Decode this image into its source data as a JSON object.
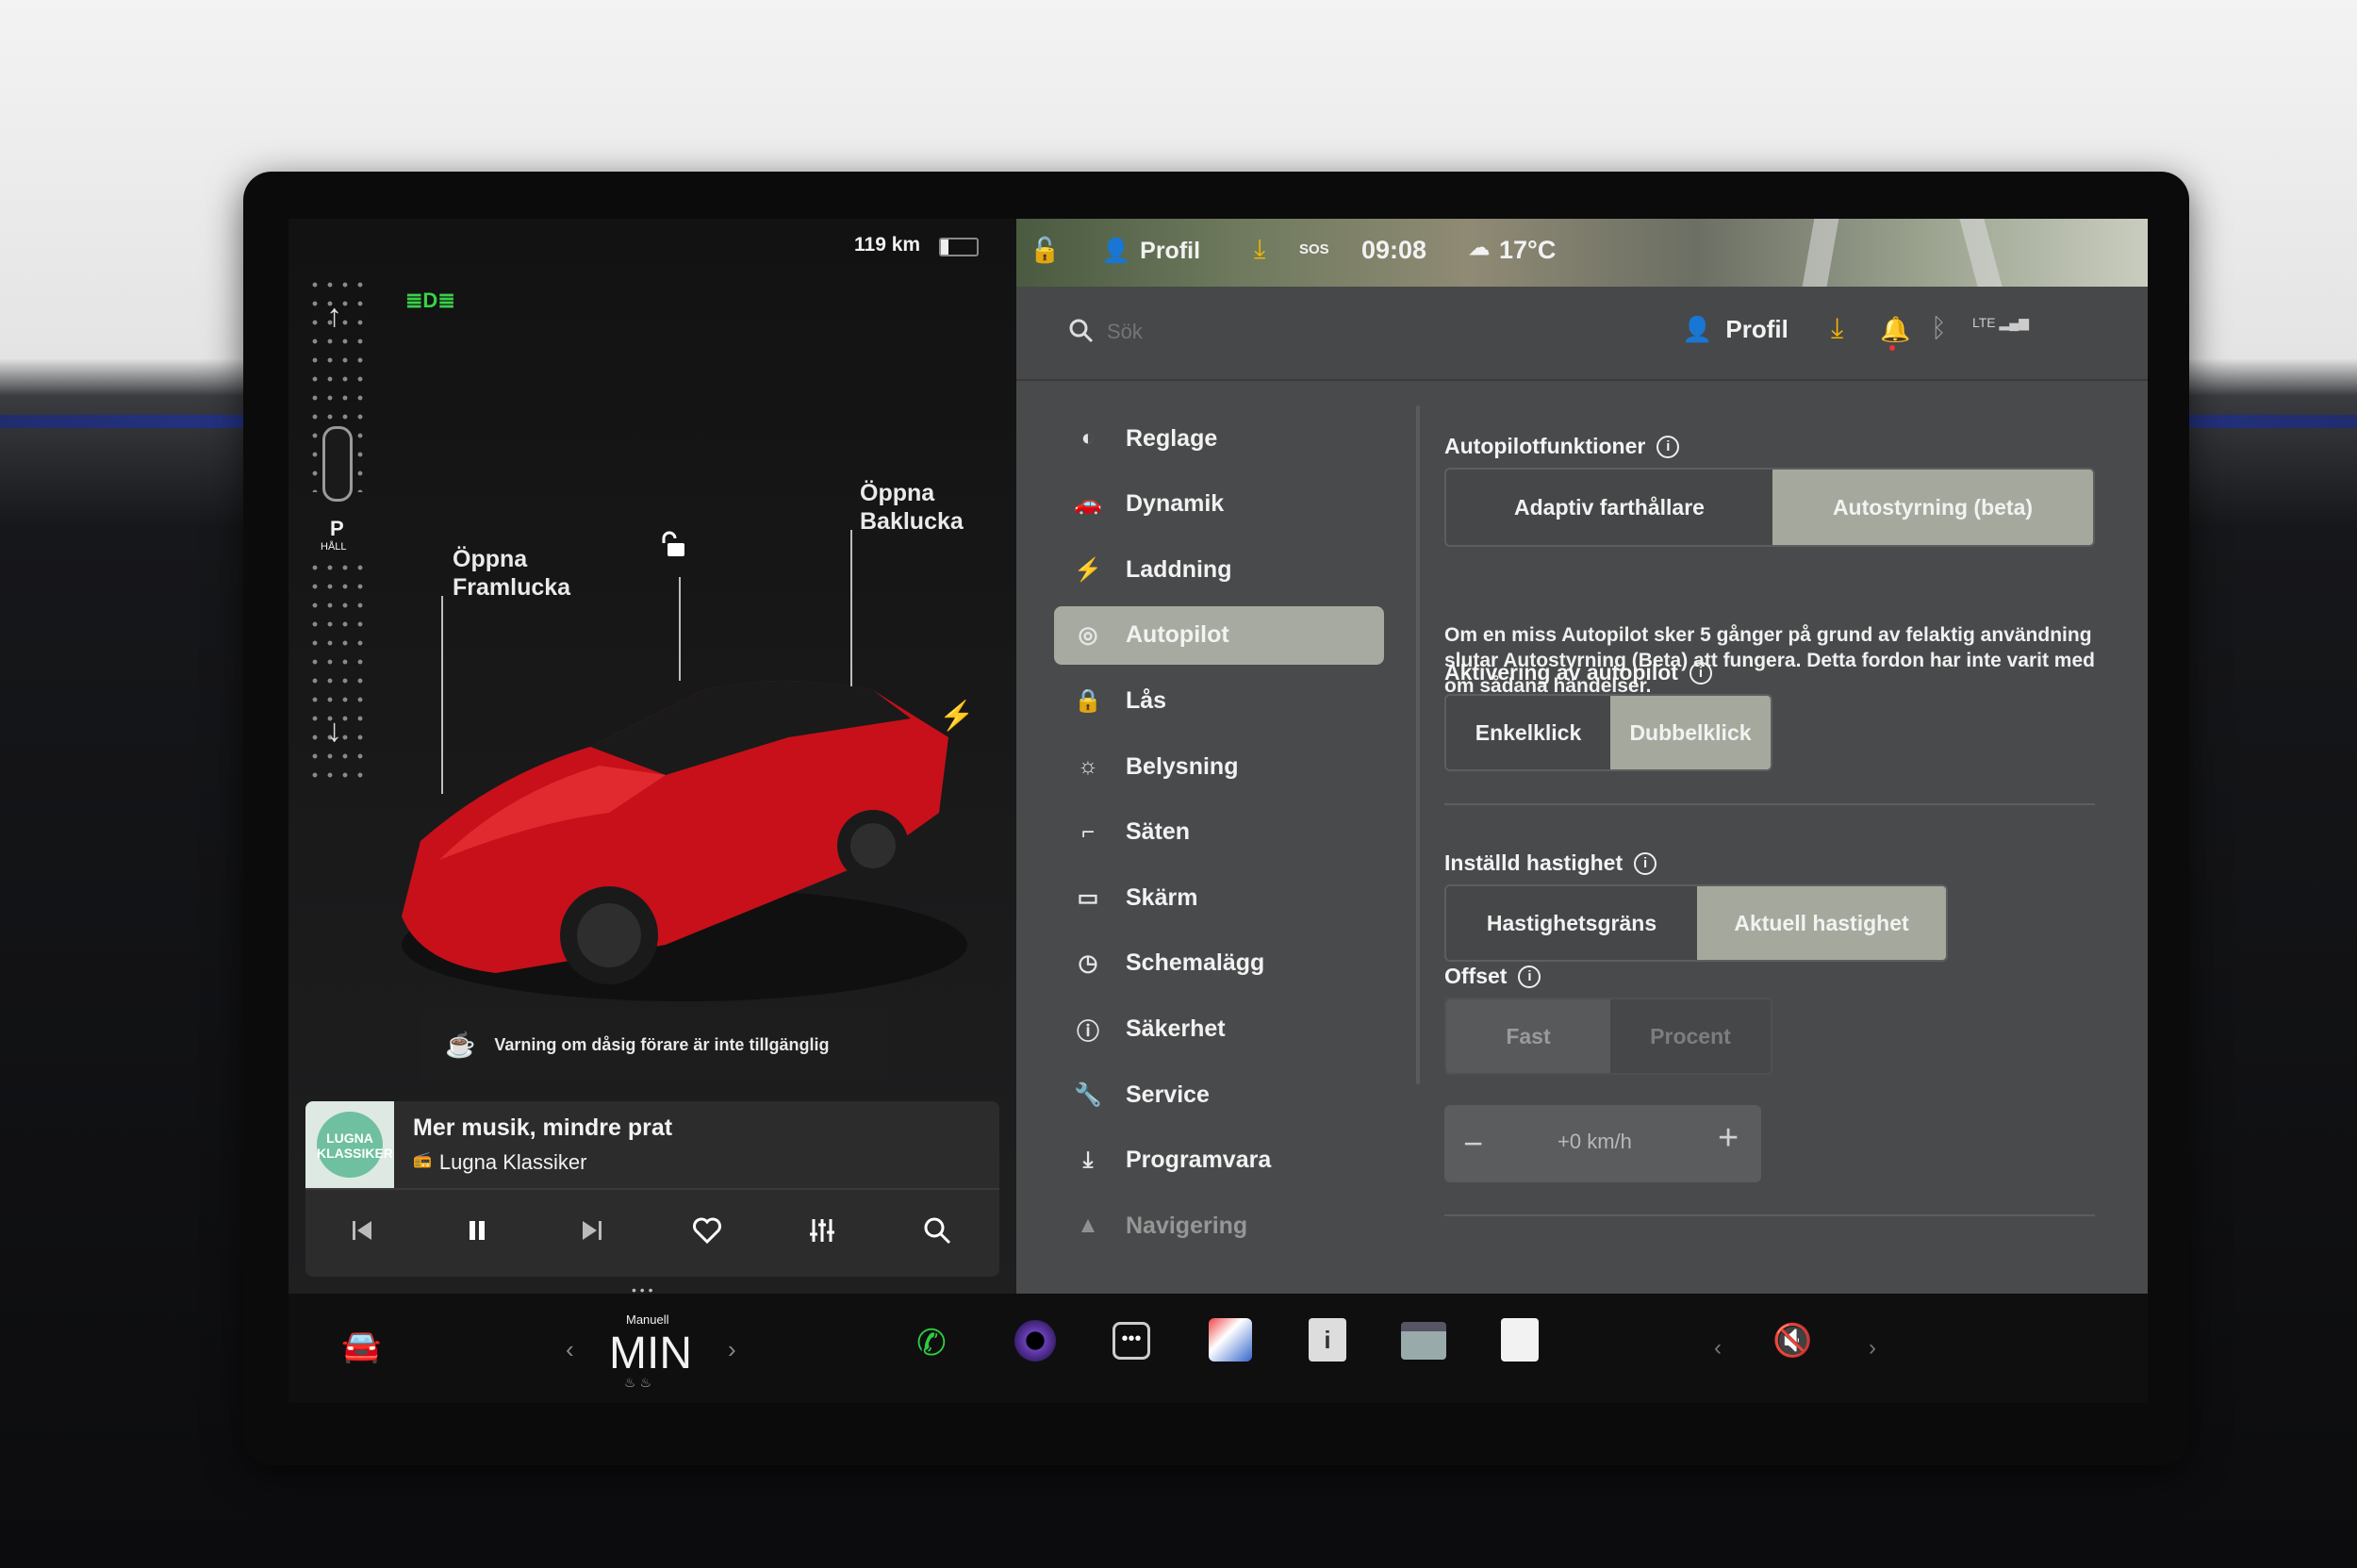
{
  "status": {
    "range": "119 km",
    "profile": "Profil",
    "time": "09:08",
    "temperature": "17°C",
    "sos": "SOS"
  },
  "left": {
    "gear": "P",
    "gear_sub": "HÅLL",
    "front_trunk": [
      "Öppna",
      "Framlucka"
    ],
    "rear_trunk": [
      "Öppna",
      "Baklucka"
    ],
    "warning": "Varning om dåsig förare är inte tillgänglig"
  },
  "media": {
    "title": "Mer musik, mindre prat",
    "station": "Lugna Klassiker",
    "album_text": "LUGNA KLASSIKER"
  },
  "search": {
    "placeholder": "Sök",
    "profile": "Profil"
  },
  "menu": [
    {
      "label": "Reglage",
      "icon": "toggle-icon"
    },
    {
      "label": "Dynamik",
      "icon": "car-icon"
    },
    {
      "label": "Laddning",
      "icon": "bolt-icon"
    },
    {
      "label": "Autopilot",
      "icon": "steering-wheel-icon",
      "selected": true
    },
    {
      "label": "Lås",
      "icon": "lock-icon"
    },
    {
      "label": "Belysning",
      "icon": "sun-icon"
    },
    {
      "label": "Säten",
      "icon": "seat-icon"
    },
    {
      "label": "Skärm",
      "icon": "display-icon"
    },
    {
      "label": "Schemalägg",
      "icon": "clock-icon"
    },
    {
      "label": "Säkerhet",
      "icon": "info-icon"
    },
    {
      "label": "Service",
      "icon": "wrench-icon"
    },
    {
      "label": "Programvara",
      "icon": "download-icon"
    },
    {
      "label": "Navigering",
      "icon": "navigation-icon"
    }
  ],
  "settings": {
    "autopilot_features": {
      "title": "Autopilotfunktioner",
      "options": [
        "Adaptiv farthållare",
        "Autostyrning (beta)"
      ],
      "selected": 1,
      "note": "Om en miss Autopilot sker 5 gånger på grund av felaktig användning slutar Autostyrning (Beta) att fungera. Detta fordon har inte varit med om sådana händelser."
    },
    "activation": {
      "title": "Aktivering av autopilot",
      "options": [
        "Enkelklick",
        "Dubbelklick"
      ],
      "selected": 1
    },
    "set_speed": {
      "title": "Inställd hastighet",
      "options": [
        "Hastighetsgräns",
        "Aktuell hastighet"
      ],
      "selected": 1
    },
    "offset": {
      "title": "Offset",
      "options": [
        "Fast",
        "Procent"
      ],
      "selected": 0,
      "value": "+0 km/h"
    }
  },
  "bottom": {
    "mode": "Manuell",
    "climate": "MIN"
  }
}
